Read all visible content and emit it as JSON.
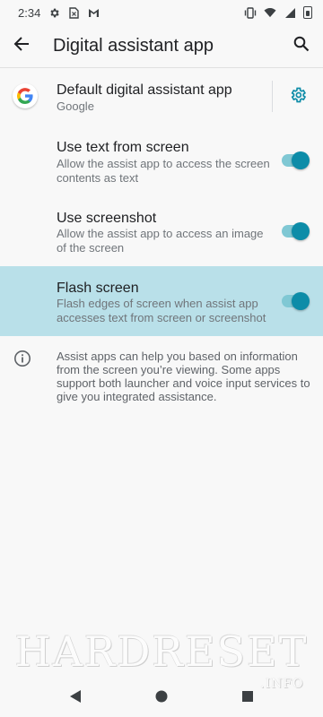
{
  "status_bar": {
    "time": "2:34",
    "icons": [
      "settings-icon",
      "sim-icon",
      "gmail-icon",
      "vibrate-icon",
      "wifi-icon",
      "signal-icon",
      "battery-icon"
    ]
  },
  "app_bar": {
    "title": "Digital assistant app",
    "back_icon": "arrow-back-icon",
    "search_icon": "search-icon"
  },
  "default_app": {
    "title": "Default digital assistant app",
    "value": "Google",
    "icon": "google-logo-icon",
    "settings_icon": "gear-icon"
  },
  "settings": [
    {
      "title": "Use text from screen",
      "description": "Allow the assist app to access the screen contents as text",
      "enabled": true,
      "highlighted": false
    },
    {
      "title": "Use screenshot",
      "description": "Allow the assist app to access an image of the screen",
      "enabled": true,
      "highlighted": false
    },
    {
      "title": "Flash screen",
      "description": "Flash edges of screen when assist app accesses text from screen or screenshot",
      "enabled": true,
      "highlighted": true
    }
  ],
  "info": {
    "icon": "info-icon",
    "text": "Assist apps can help you based on information from the screen you’re viewing. Some apps support both launcher and voice input services to give you integrated assistance."
  },
  "watermark": {
    "main": "HARDRESET",
    "sub": ".INFO"
  },
  "nav_bar": {
    "icons": [
      "back-triangle-icon",
      "home-circle-icon",
      "recents-square-icon"
    ]
  },
  "colors": {
    "accent": "#0d8ca8",
    "toggle_track": "#80c8d4",
    "highlight_row": "#b9e0e9",
    "background": "#f8f8f8"
  }
}
